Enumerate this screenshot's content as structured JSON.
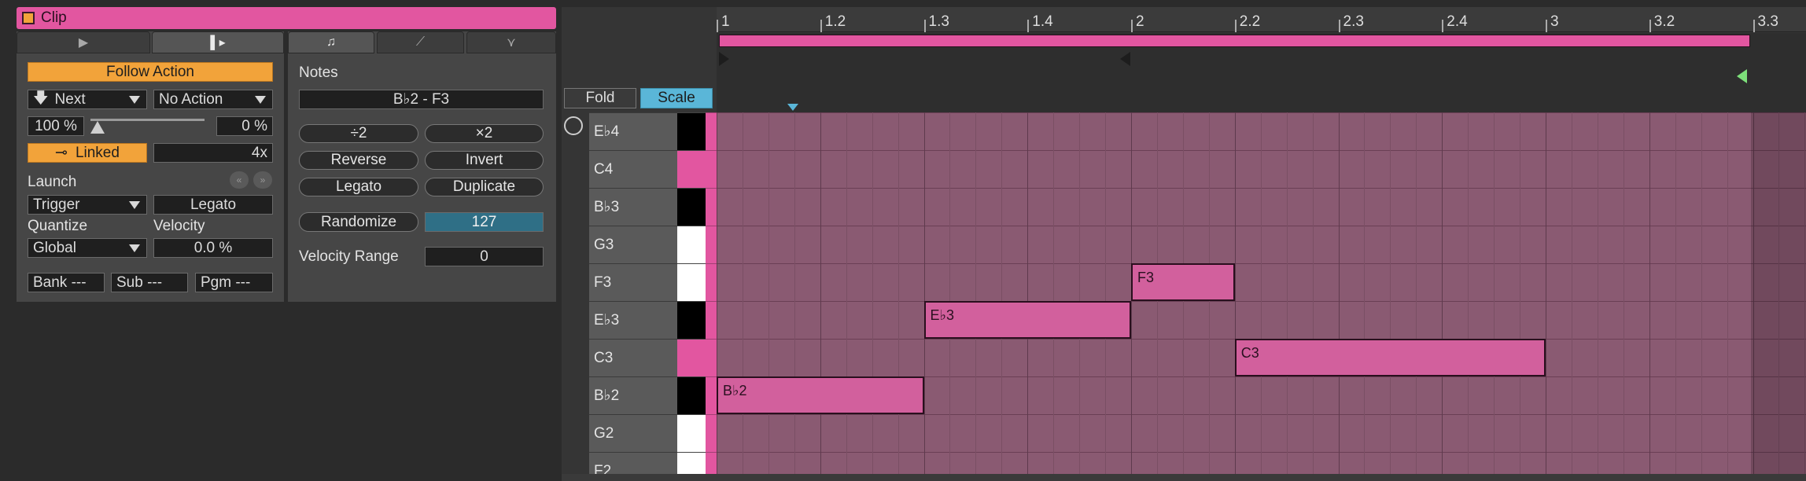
{
  "clip": {
    "title": "Clip"
  },
  "tabs_left": [
    {
      "icon": "play-clip-icon",
      "selected": false
    },
    {
      "icon": "launch-icon",
      "selected": true
    }
  ],
  "tabs_right": [
    {
      "icon": "note-icon",
      "selected": true
    },
    {
      "icon": "envelope-icon",
      "selected": false
    },
    {
      "icon": "mpe-icon",
      "selected": false
    }
  ],
  "follow": {
    "button": "Follow Action",
    "action_a": "Next",
    "action_b": "No Action",
    "chance_a": "100 %",
    "chance_b": "0 %",
    "linked": "Linked",
    "multiplier": "4x"
  },
  "launch": {
    "label": "Launch",
    "mode": "Trigger",
    "legato": "Legato",
    "quantize_label": "Quantize",
    "quantize": "Global",
    "velocity_label": "Velocity",
    "velocity": "0.0 %"
  },
  "program": {
    "bank": "Bank ---",
    "sub": "Sub ---",
    "pgm": "Pgm ---"
  },
  "notes": {
    "label": "Notes",
    "range": "B♭2 - F3",
    "half": "÷2",
    "double": "×2",
    "reverse": "Reverse",
    "invert": "Invert",
    "legato": "Legato",
    "duplicate": "Duplicate",
    "randomize": "Randomize",
    "randomize_value": "127",
    "velocity_range_label": "Velocity Range",
    "velocity_range": "0"
  },
  "editor": {
    "fold": "Fold",
    "scale": "Scale",
    "ruler": [
      "1",
      "1.2",
      "1.3",
      "1.4",
      "2",
      "2.2",
      "2.3",
      "2.4",
      "3",
      "3.2",
      "3.3"
    ],
    "keys": [
      {
        "name": "E♭4",
        "black": true
      },
      {
        "name": "C4",
        "root": true
      },
      {
        "name": "B♭3",
        "black": true
      },
      {
        "name": "G3",
        "black": false
      },
      {
        "name": "F3",
        "black": false
      },
      {
        "name": "E♭3",
        "black": true
      },
      {
        "name": "C3",
        "root": true
      },
      {
        "name": "B♭2",
        "black": true
      },
      {
        "name": "G2",
        "black": false
      },
      {
        "name": "F2",
        "black": false
      }
    ],
    "notes": [
      {
        "label": "B♭2",
        "row": 7,
        "start": 1.0,
        "end": 1.25
      },
      {
        "label": "E♭3",
        "row": 5,
        "start": 1.25,
        "end": 1.5
      },
      {
        "label": "F3",
        "row": 4,
        "start": 1.5,
        "end": 1.625
      },
      {
        "label": "C3",
        "row": 6,
        "start": 1.625,
        "end": 2.0
      }
    ]
  },
  "colors": {
    "accent": "#e256a0",
    "orange": "#f2a33a",
    "scale": "#5ab6d8",
    "velocity": "#2f6f86"
  }
}
